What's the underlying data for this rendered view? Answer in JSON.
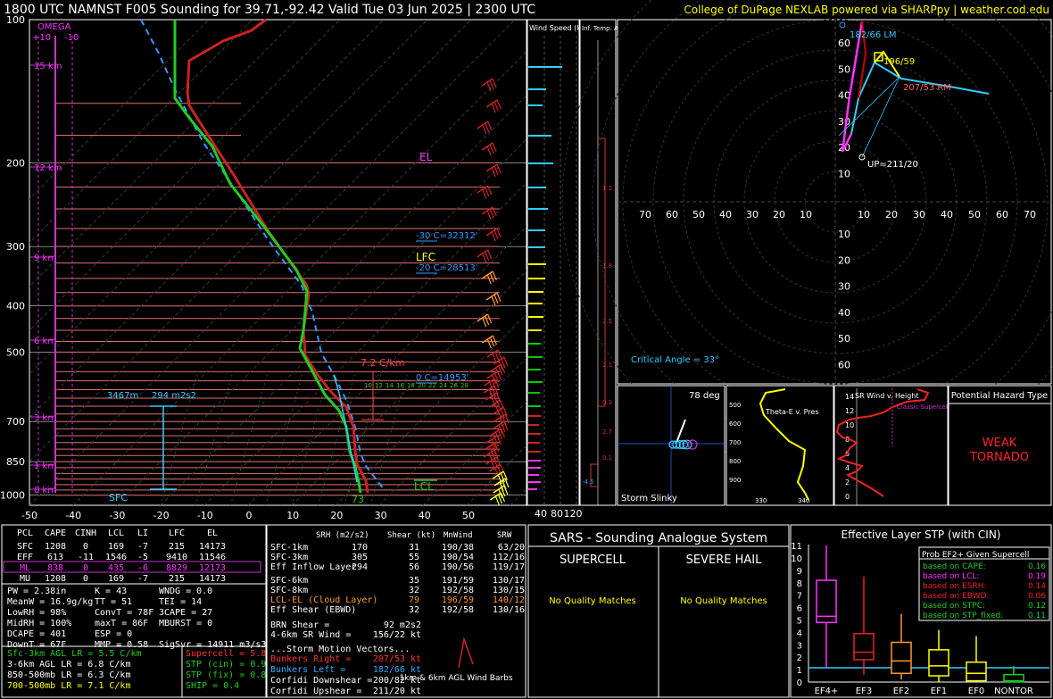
{
  "header": {
    "title": "1800 UTC NAMNST F005 Sounding for 39.71,-92.42 Valid  Tue 03 Jun 2025 | 2300 UTC",
    "credit": "College of DuPage NEXLAB powered via SHARPpy | weather.cod.edu"
  },
  "skewt": {
    "pressure_labels": [
      "100",
      "200",
      "300",
      "400",
      "500",
      "700",
      "850",
      "1000"
    ],
    "temp_labels": [
      "-50",
      "-40",
      "-30",
      "-20",
      "-10",
      "0",
      "10",
      "20",
      "30",
      "40",
      "50"
    ],
    "height_labels": [
      "15 km",
      "12 km",
      "9 km",
      "6 km",
      "3 km",
      "1 km",
      "0 km"
    ],
    "omega_label": "OMEGA",
    "omega_ticks": [
      "+10",
      "-10"
    ],
    "el_label": "EL",
    "lfc_label": "LFC",
    "lcl_label": "LCL",
    "minus30": "-30 C=32312'",
    "minus20": "-20 C=28513'",
    "zero": "0 C=14953'",
    "lapse": "7.2 C/km",
    "inflow_height": "3467m",
    "inflow_srh": "294 m2s2",
    "sfc": "SFC",
    "sfc_temp": "73",
    "wetbulb_ticks": [
      "10",
      "12",
      "14",
      "16",
      "18",
      "20",
      "22",
      "24",
      "26",
      "28"
    ]
  },
  "wind_speed": {
    "title": "Wind Speed (knots)",
    "ticks": [
      "40",
      "80",
      "120"
    ]
  },
  "temp_adv": {
    "title": "Inf. Temp. Adv (C/hr)",
    "values": [
      "1.1",
      "1.8",
      "2.5",
      "2.1",
      "0.3",
      "2.7",
      "0.1",
      "-4.5"
    ]
  },
  "hodograph": {
    "rings": [
      "10",
      "20",
      "30",
      "40",
      "50",
      "60"
    ],
    "xticks_left": [
      "70",
      "60",
      "50",
      "40",
      "30",
      "20",
      "10"
    ],
    "xticks_right": [
      "10",
      "20",
      "30",
      "40",
      "50",
      "60",
      "70"
    ],
    "yticks_up": [
      "60",
      "50",
      "40",
      "30",
      "20",
      "10"
    ],
    "yticks_down": [
      "10",
      "20",
      "30",
      "40",
      "50",
      "60"
    ],
    "lm_label": "182/66 LM",
    "mean_label": "196/59",
    "rm_label": "207/53 RM",
    "up_label": "UP=211/20",
    "critical_angle": "Critical Angle = 33°"
  },
  "storm_slinky": {
    "title": "Storm Slinky",
    "angle": "78 deg"
  },
  "theta_e": {
    "title": "Theta-E v. Pres",
    "yticks": [
      "500",
      "600",
      "700",
      "800",
      "900"
    ],
    "xticks": [
      "330",
      "340",
      "350"
    ]
  },
  "sr_wind": {
    "title": "SR Wind v. Height",
    "yticks": [
      "14",
      "12",
      "10",
      "8",
      "6",
      "4",
      "2",
      "0"
    ],
    "annotation": "Classic Supercell"
  },
  "hazard": {
    "title": "Potential Hazard Type",
    "value": "WEAK TORNADO"
  },
  "parcel_table": {
    "headers": [
      "PCL",
      "CAPE",
      "CINH",
      "LCL",
      "LI",
      "LFC",
      "EL"
    ],
    "rows": [
      [
        "SFC",
        "1208",
        "0",
        "169",
        "-7",
        "215",
        "14173"
      ],
      [
        "EFF",
        "613",
        "-11",
        "1546",
        "-5",
        "9410",
        "11546"
      ],
      [
        "ML",
        "838",
        "0",
        "435",
        "-6",
        "8829",
        "12173"
      ],
      [
        "MU",
        "1208",
        "0",
        "169",
        "-7",
        "215",
        "14173"
      ]
    ]
  },
  "indices": {
    "col1": [
      "PW = 2.38in",
      "MeanW = 16.9g/kg",
      "LowRH = 98%",
      "MidRH = 100%",
      "DCAPE = 401",
      "DownT = 67F"
    ],
    "col2": [
      "K = 43",
      "TT = 51",
      "ConvT = 78F",
      "maxT = 86F",
      "ESP = 0",
      "MMP = 0.58"
    ],
    "col3": [
      "WNDG = 0.0",
      "TEI = 14",
      "3CAPE = 27",
      "MBURST = 0",
      "",
      "SigSvr = 14911 m3/s3"
    ]
  },
  "lapse_rates": [
    "Sfc-3km AGL LR = 5.5 C/km",
    "3-6km AGL LR = 6.8 C/km",
    "850-500mb LR = 6.3 C/km",
    "700-500mb LR = 7.1 C/km"
  ],
  "composites": [
    "Supercell = 5.8",
    "STP (cin) = 0.9",
    "STP (fix) = 0.8",
    "SHIP = 0.4"
  ],
  "kin_table": {
    "headers": [
      "SRH (m2/s2)",
      "Shear (kt)",
      "MnWind",
      "SRW"
    ],
    "rows": [
      [
        "SFC-1km",
        "170",
        "31",
        "190/38",
        "63/20"
      ],
      [
        "SFC-3km",
        "305",
        "55",
        "190/54",
        "112/16"
      ],
      [
        "Eff Inflow Layer",
        "294",
        "56",
        "190/56",
        "119/17"
      ],
      [
        "SFC-6km",
        "35",
        "191/59",
        "130/17",
        ""
      ],
      [
        "SFC-8km",
        "32",
        "192/58",
        "130/15",
        ""
      ],
      [
        "LCL-EL (Cloud Layer)",
        "79",
        "196/59",
        "140/12",
        ""
      ],
      [
        "Eff Shear (EBWD)",
        "32",
        "192/58",
        "130/16",
        ""
      ]
    ],
    "brn_shear_label": "BRN Shear =",
    "brn_shear": "92 m2s2",
    "sr_wind_label": "4-6km SR Wind =",
    "sr_wind": "156/22 kt",
    "storm_vectors_title": "...Storm Motion Vectors...",
    "vectors": [
      [
        "Bunkers Right =",
        "207/53 kt"
      ],
      [
        "Bunkers Left =",
        "182/66 kt"
      ],
      [
        "Corfidi Downshear =",
        "200/82 kt"
      ],
      [
        "Corfidi Upshear =",
        "211/20 kt"
      ]
    ],
    "barb_caption": "1km & 6km AGL Wind Barbs"
  },
  "sars": {
    "title": "SARS - Sounding Analogue System",
    "supercell": "SUPERCELL",
    "hail": "SEVERE HAIL",
    "supercell_result": "No Quality Matches",
    "hail_result": "No Quality Matches"
  },
  "stp_panel": {
    "title": "Effective Layer STP (with CIN)",
    "yticks": [
      "11",
      "10",
      "9",
      "8",
      "7",
      "6",
      "5",
      "4",
      "3",
      "2",
      "1",
      "0"
    ],
    "categories": [
      "EF4+",
      "EF3",
      "EF2",
      "EF1",
      "EF0",
      "NONTOR"
    ],
    "prob_title": "Prob EF2+ Given Supercell",
    "probs": [
      [
        "based on CAPE:",
        "0.16"
      ],
      [
        "based on LCL:",
        "0.19"
      ],
      [
        "based on ESRH:",
        "0.14"
      ],
      [
        "based on EBWD:",
        "0.06"
      ],
      [
        "based on STPC:",
        "0.12"
      ],
      [
        "based on STP_fixed:",
        "0.11"
      ]
    ]
  },
  "colors": {
    "accent_yellow": "#ffff00",
    "temp": "#dd2222",
    "dewpoint": "#22cc22",
    "wetbulb": "#33ccff",
    "magenta": "#ff33ff"
  },
  "chart_data": {
    "type": "line",
    "title": "",
    "xlabel": "",
    "ylabel": "",
    "xlim": [
      -50,
      50
    ],
    "ylim": [
      1000,
      100
    ],
    "ylog": true,
    "series": [
      {
        "name": "",
        "x": [
          -55,
          -50,
          -52,
          -46,
          -33,
          -20,
          -8,
          2,
          12,
          18,
          22,
          26
        ],
        "y": [
          100,
          150,
          200,
          250,
          300,
          400,
          500,
          600,
          700,
          800,
          900,
          1000
        ]
      },
      {
        "name": "",
        "x": [
          -62,
          -56,
          -52,
          -46,
          -33,
          -20,
          -12,
          -4,
          6,
          12,
          18,
          21
        ],
        "y": [
          100,
          150,
          200,
          250,
          300,
          400,
          500,
          600,
          700,
          800,
          900,
          1000
        ]
      }
    ]
  }
}
